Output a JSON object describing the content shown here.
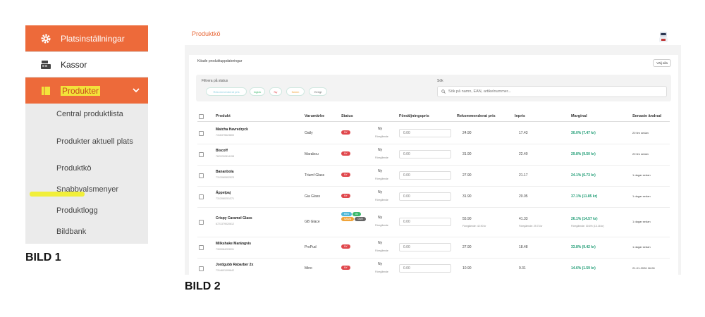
{
  "sidebar": {
    "items": [
      {
        "label": "Platsinställningar",
        "icon": "gear-icon"
      },
      {
        "label": "Kassor",
        "icon": "register-icon"
      },
      {
        "label": "Produkter",
        "icon": "box-icon"
      }
    ],
    "subitems": [
      "Central produktlista",
      "Produkter aktuell plats",
      "Produktkö",
      "Snabbvalsmenyer",
      "Produktlogg",
      "Bildbank"
    ],
    "caption": "BILD 1",
    "accent": "#ed6a3a",
    "highlight": "#f3e33a"
  },
  "panel": {
    "caption": "BILD 2",
    "page_title": "Produktkö",
    "card_title": "Köade produktuppdateringar",
    "select_all": "Välj alla",
    "filter": {
      "label": "Filtrera på status",
      "chips": [
        "Rekommenderat pris",
        "Ingick",
        "Ny",
        "Namn",
        "Övrigt"
      ]
    },
    "search": {
      "label": "Sök",
      "placeholder": "Sök på namn, EAN, artikelnummer..."
    },
    "columns": [
      "Produkt",
      "Varumärke",
      "Status",
      "Försäljningspris",
      "Rekommenderat pris",
      "Inpris",
      "Marginal",
      "Senaste ändrad"
    ],
    "rows": [
      {
        "name": "Matcha Havredryck",
        "ean": "7316375623800",
        "brand": "Oatly",
        "badges": [
          "NY"
        ],
        "ny": "Ny",
        "prev": "Föregående",
        "price": "0.00",
        "rek": "24.90",
        "rek_sub": "",
        "inpris": "17.43",
        "inpris_sub": "",
        "marginal": "30.0% (7.47 kr)",
        "marg_sub": "",
        "last": "20 tim sedan"
      },
      {
        "name": "Biscoff",
        "ean": "7622202814198",
        "brand": "Marabou",
        "badges": [
          "NY"
        ],
        "ny": "Ny",
        "prev": "Föregående",
        "price": "0.00",
        "rek": "31.90",
        "rek_sub": "",
        "inpris": "22.40",
        "inpris_sub": "",
        "marginal": "29.8% (9.50 kr)",
        "marg_sub": "",
        "last": "20 tim sedan"
      },
      {
        "name": "Bananbola",
        "ean": "7312060502523",
        "brand": "Triumf Glass",
        "badges": [
          "NY"
        ],
        "ny": "Ny",
        "prev": "Föregående",
        "price": "0.00",
        "rek": "27.90",
        "rek_sub": "",
        "inpris": "21.17",
        "inpris_sub": "",
        "marginal": "24.1% (6.73 kr)",
        "marg_sub": "",
        "last": "1 dagar sedan"
      },
      {
        "name": "Äppelpaj",
        "ean": "7312060201371",
        "brand": "Gia Glass",
        "badges": [
          "NY"
        ],
        "ny": "Ny",
        "prev": "Föregående",
        "price": "0.00",
        "rek": "31.90",
        "rek_sub": "",
        "inpris": "20.05",
        "inpris_sub": "",
        "marginal": "37.1% (11.85 kr)",
        "marg_sub": "",
        "last": "1 dagar sedan"
      },
      {
        "name": "Crispy Caramel Glass",
        "ean": "6721379020612",
        "brand": "GB Glace",
        "badges": [
          "REK",
          "IN",
          "NAMN",
          "ÖVR"
        ],
        "ny": "Ny",
        "prev": "Föregående",
        "price": "0.00",
        "rek": "55.90",
        "rek_sub": "Föregående: 42.90 kr",
        "inpris": "41.33",
        "inpris_sub": "Föregående: 29.73 kr",
        "marginal": "26.1% (14.57 kr)",
        "marg_sub": "Föregående: 30.6% (13.16 kr)",
        "last": "1 dagar sedan"
      },
      {
        "name": "Milkshake Marängvis",
        "ean": "7300084203091",
        "brand": "ProPud",
        "badges": [
          "NY"
        ],
        "ny": "Ny",
        "prev": "Föregående",
        "price": "0.00",
        "rek": "27.90",
        "rek_sub": "",
        "inpris": "18.48",
        "inpris_sub": "",
        "marginal": "33.8% (9.42 kr)",
        "marg_sub": "",
        "last": "1 dagar sedan"
      },
      {
        "name": "Jordgubb Rabarber 2x",
        "ean": "7314601099642",
        "brand": "Mino",
        "badges": [
          "NY"
        ],
        "ny": "Ny",
        "prev": "Föregående",
        "price": "0.00",
        "rek": "10.90",
        "rek_sub": "",
        "inpris": "9.31",
        "inpris_sub": "",
        "marginal": "14.6% (1.59 kr)",
        "marg_sub": "",
        "last": "21-01-2026 16:08"
      }
    ],
    "badge_colors": {
      "NY": "#e0474c",
      "REK": "#4fb8d8",
      "IN": "#3bb86c",
      "NAMN": "#f0a43a",
      "ÖVR": "#666666"
    },
    "margin_color": "#1e9c74"
  }
}
